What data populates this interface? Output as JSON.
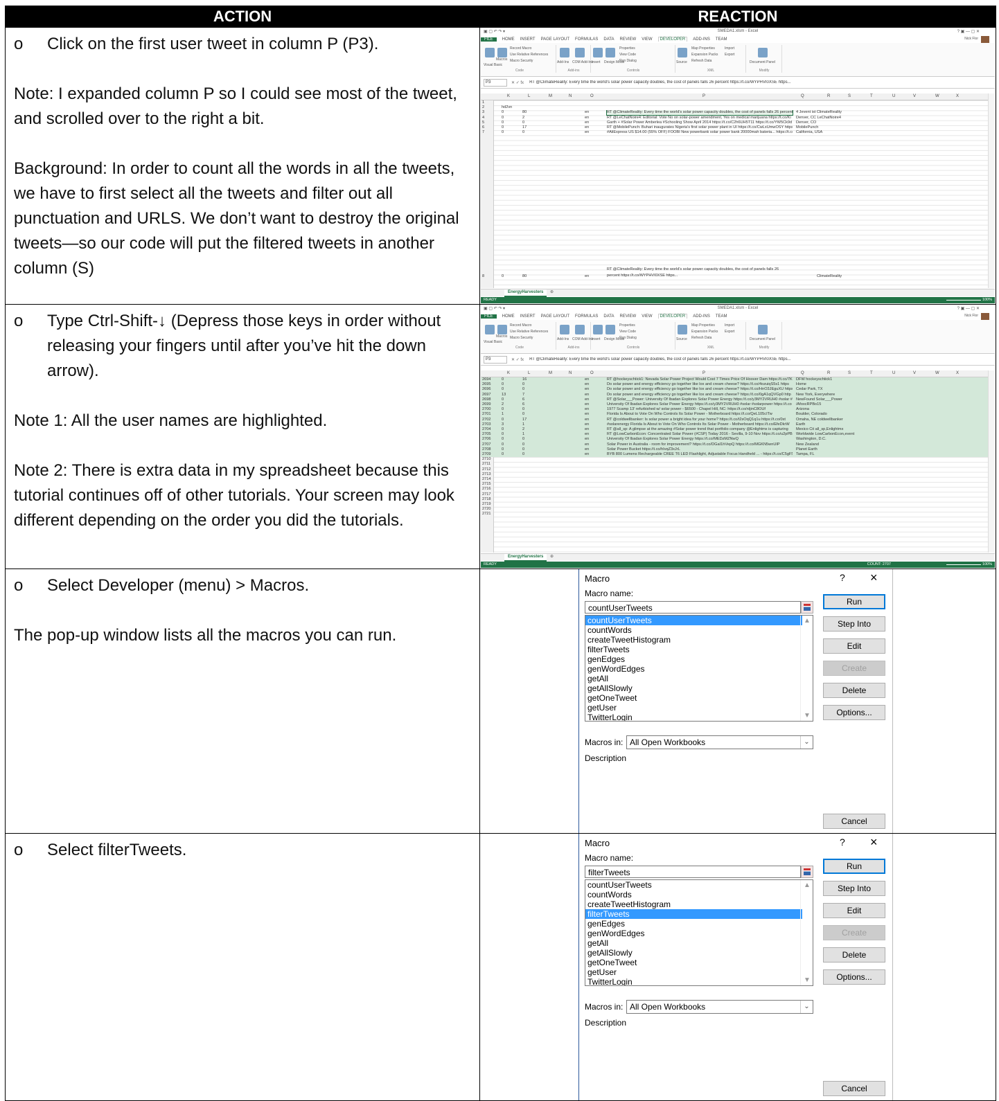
{
  "headers": {
    "action": "ACTION",
    "reaction": "REACTION"
  },
  "rows": [
    {
      "bullet": "Click on the first user tweet in column P (P3).",
      "paras": [
        "Note: I expanded column P so I could see most of the tweet, and scrolled over to the right a bit.",
        "Background: In order to count all the words in all the tweets, we have to first select all the tweets and filter out all punctuation and URLS. We don’t want to destroy the original tweets—so our code will put the filtered tweets in another column (S)"
      ]
    },
    {
      "bullet": "Type Ctrl-Shift-↓ (Depress those keys in order without releasing your fingers until after you’ve hit the down arrow).",
      "paras": [
        "Note 1: All the user names are highlighted.",
        "Note 2: There is extra data in my spreadsheet because this tutorial continues off of other tutorials. Your screen may look different depending on the order you did the tutorials."
      ]
    },
    {
      "bullet": "Select Developer (menu) > Macros.",
      "paras": [
        "The pop-up window lists all the macros you can run."
      ]
    },
    {
      "bullet": "Select filterTweets.",
      "paras": []
    }
  ],
  "excel": {
    "title": "SMEDA1.xlsm - Excel",
    "user": "Nick Flor",
    "tabs": [
      "FILE",
      "HOME",
      "INSERT",
      "PAGE LAYOUT",
      "FORMULAS",
      "DATA",
      "REVIEW",
      "VIEW",
      "DEVELOPER",
      "ADD-INS",
      "TEAM"
    ],
    "ribbon": {
      "visual_basic": "Visual Basic",
      "macros": "Macros",
      "record_macro": "Record Macro",
      "use_relative": "Use Relative References",
      "macro_security": "Macro Security",
      "code": "Code",
      "addins": "Add-Ins",
      "com_addins": "COM Add-Ins",
      "addins_group": "Add-ins",
      "insert": "Insert",
      "design_mode": "Design Mode",
      "properties": "Properties",
      "view_code": "View Code",
      "run_dialog": "Run Dialog",
      "controls": "Controls",
      "source": "Source",
      "map_properties": "Map Properties",
      "expansion_packs": "Expansion Packs",
      "refresh_data": "Refresh Data",
      "import": "Import",
      "export": "Export",
      "xml": "XML",
      "document_panel": "Document Panel",
      "modify": "Modify"
    },
    "namebox": "P3",
    "formula": "RT @ClimateReality: Every time the world's solar power capacity doubles, the cost of panels falls 26 percent https://t.co/WYPHVI0XSE https...",
    "columns": [
      "K",
      "L",
      "M",
      "N",
      "O",
      "P",
      "Q",
      "R",
      "S",
      "T",
      "U",
      "V",
      "W",
      "X"
    ],
    "sheet_tab": "EnergyHarvesters",
    "status_ready": "READY",
    "zoom": "100%",
    "shot1": {
      "rows": [
        {
          "n": "1",
          "k": "",
          "l": "",
          "m": "",
          "o": "",
          "p": "",
          "q": ""
        },
        {
          "n": "2",
          "k": "hd2vn",
          "l": "",
          "m": "",
          "o": "",
          "p": "",
          "q": ""
        },
        {
          "n": "3",
          "k": "0",
          "l": "80",
          "m": "",
          "o": "en",
          "p": "RT @ClimateReality: Every time the world's solar power capacity doubles, the cost of panels falls 26 percent",
          "q": "4 Jevent ist ClimateReality"
        },
        {
          "n": "4",
          "k": "0",
          "l": "2",
          "m": "",
          "o": "en",
          "p": "RT @LeChatNoire4: Editorial: Vote No on solar-power amendment, Yes on medical marijuana https://t.co/Ki",
          "q": "Denver, CC LeChatNoire4"
        },
        {
          "n": "5",
          "k": "0",
          "l": "0",
          "m": "",
          "o": "en",
          "p": "Garth + #Solar Power Amberlea #Schooling Show April 2014 https://t.co/C2h6UH5T11 https://t.co/YW5Ck9d",
          "q": "Denver, CO"
        },
        {
          "n": "6",
          "k": "0",
          "l": "17",
          "m": "",
          "o": "en",
          "p": "RT @MobilePunch: Buhari inaugurates Nigeria's first solar power plant in UI https://t.co/CwLxUmwOSY https://t.co/pZc",
          "q": "MobilePunch"
        },
        {
          "n": "7",
          "k": "0",
          "l": "0",
          "m": "",
          "o": "en",
          "p": "#AliExpress US $14.00 (55% OFF) FOOBI New powerbank solar power bank 20000mah bateria... https://t.co/",
          "q": "California, USA"
        }
      ],
      "tall_row": {
        "n": "8",
        "k": "0",
        "l": "80",
        "o": "en",
        "p1": "RT @ClimateReality: Every time the world's solar power capacity doubles, the cost of panels falls 26",
        "p2": "percent https://t.co/WYPHVI0XSE https...",
        "q": "ClimateReality"
      }
    },
    "shot2": {
      "rows": [
        {
          "n": "2694",
          "k": "0",
          "l": "16",
          "o": "en",
          "p": "RT @hockeyschtick1: Nevada Solar Power Project Would Cost 7 Times Price Of Hoover Dam https://t.co/7K",
          "q": "DFW      hockeyschtick1"
        },
        {
          "n": "2695",
          "k": "0",
          "l": "0",
          "o": "en",
          "p": "Do solar power and energy efficiency go together like lox and cream cheese? https://t.co/4ozuiqS5s1 https",
          "q": "Home"
        },
        {
          "n": "2696",
          "k": "0",
          "l": "0",
          "o": "en",
          "p": "Do solar power and energy efficiency go together like lox and cream cheese? https://t.co/HnO3JEguXU https",
          "q": "Cedar Park, TX"
        },
        {
          "n": "2697",
          "k": "13",
          "l": "7",
          "o": "en",
          "p": "Do solar power and energy efficiency go together like lox and cream cheese? https://t.co/0gA1qQVGp0 http",
          "q": "New York, Everywhere"
        },
        {
          "n": "2698",
          "k": "0",
          "l": "6",
          "o": "en",
          "p": "RT @Solar___Power: University Of Ibadan Explores Solar Power Energy https://t.co/y3MY2VRUH0 #solar #s",
          "q": "NewFound Solar___Power"
        },
        {
          "n": "2699",
          "k": "2",
          "l": "6",
          "o": "en",
          "p": "University Of Ibadan Explores Solar Power Energy https://t.co/y3MY2VRUH0 #solar #solarpower https://t.co",
          "q": "/AfoxcRPBo15"
        },
        {
          "n": "2700",
          "k": "0",
          "l": "0",
          "o": "en",
          "p": "1977 Scamp 13' refurbished w/ solar power - $6500 - Chapel Hill, NC: https://t.co/nIjinC8OUf",
          "q": "Arizona"
        },
        {
          "n": "2701",
          "k": "1",
          "l": "0",
          "o": "en",
          "p": "Florida Is About to Vote On Who Controls Its Solar Power - Motherboard https://t.co/QeL105cITw",
          "q": "Boulder, Colorado"
        },
        {
          "n": "2702",
          "k": "0",
          "l": "17",
          "o": "en",
          "p": "RT @coldwellbanker: Is solar power a bright idea for your home? https://t.co/t2sOqQ1q1u https://t.co/0xt",
          "q": "Omaha, NE coldwellbanker"
        },
        {
          "n": "2703",
          "k": "3",
          "l": "1",
          "o": "en",
          "p": "#solarenergy Florida Is About to Vote On Who Controls Its Solar Power - Motherboard https://t.co/EfeDkrW",
          "q": "Earth"
        },
        {
          "n": "2704",
          "k": "0",
          "l": "2",
          "o": "en",
          "p": "RT @all_sp: A glimpse at the amazing #Solar power trend that portfolio company @Enlightmx is capturing",
          "q": "Mexico Cit all_sp,Enlightmx"
        },
        {
          "n": "2705",
          "k": "0",
          "l": "1",
          "o": "en",
          "p": "RT @LowCarbonEcon: Concentrated Solar Power (#CSP) Today 2016 - Sevilla, 9-10 Nov https://t.co/u2pPB5",
          "q": "Worldwide LowCarbonEcon,event"
        },
        {
          "n": "2706",
          "k": "0",
          "l": "0",
          "o": "en",
          "p": "University Of Ibadan Explores Solar Power Energy https://t.co/MEDzMZNwQ",
          "q": "Washington, D.C."
        },
        {
          "n": "2707",
          "k": "0",
          "l": "0",
          "o": "en",
          "p": "Solar Power in Australia - room for improvement? https://t.co/DGaI1hVepQ https://t.co/MGKN5wnUIP",
          "q": "New Zealand"
        },
        {
          "n": "2708",
          "k": "0",
          "l": "0",
          "o": "en",
          "p": "Solar Power Bucket https://t.co/hIvqZ3xJrL",
          "q": "Planet Earth"
        },
        {
          "n": "2709",
          "k": "0",
          "l": "0",
          "o": "en",
          "p": "BYB 800 Lumens Rechargeable CREE T6 LED Flashlight, Adjustable Focus Handheld ... - https://t.co/C5gF5p0k",
          "q": "Tampa, FL"
        }
      ],
      "empty_rows": [
        "2710",
        "2711",
        "2712",
        "2713",
        "2714",
        "2715",
        "2716",
        "2717",
        "2718",
        "2719",
        "2720",
        "2721"
      ],
      "count": "COUNT: 2707"
    }
  },
  "dialog": {
    "title": "Macro",
    "help": "?",
    "close": "×",
    "name_label": "Macro name:",
    "macros": [
      "countUserTweets",
      "countWords",
      "createTweetHistogram",
      "filterTweets",
      "genEdges",
      "genWordEdges",
      "getAll",
      "getAllSlowly",
      "getOneTweet",
      "getUser",
      "TwitterLogin"
    ],
    "buttons": {
      "run": "Run",
      "step": "Step Into",
      "edit": "Edit",
      "create": "Create",
      "delete": "Delete",
      "options": "Options...",
      "cancel": "Cancel"
    },
    "macros_in_label": "Macros in:",
    "macros_in_value": "All Open Workbooks",
    "description_label": "Description",
    "d1": {
      "name_value": "countUserTweets",
      "selected": "countUserTweets"
    },
    "d2": {
      "name_value": "filterTweets",
      "selected": "filterTweets"
    }
  }
}
